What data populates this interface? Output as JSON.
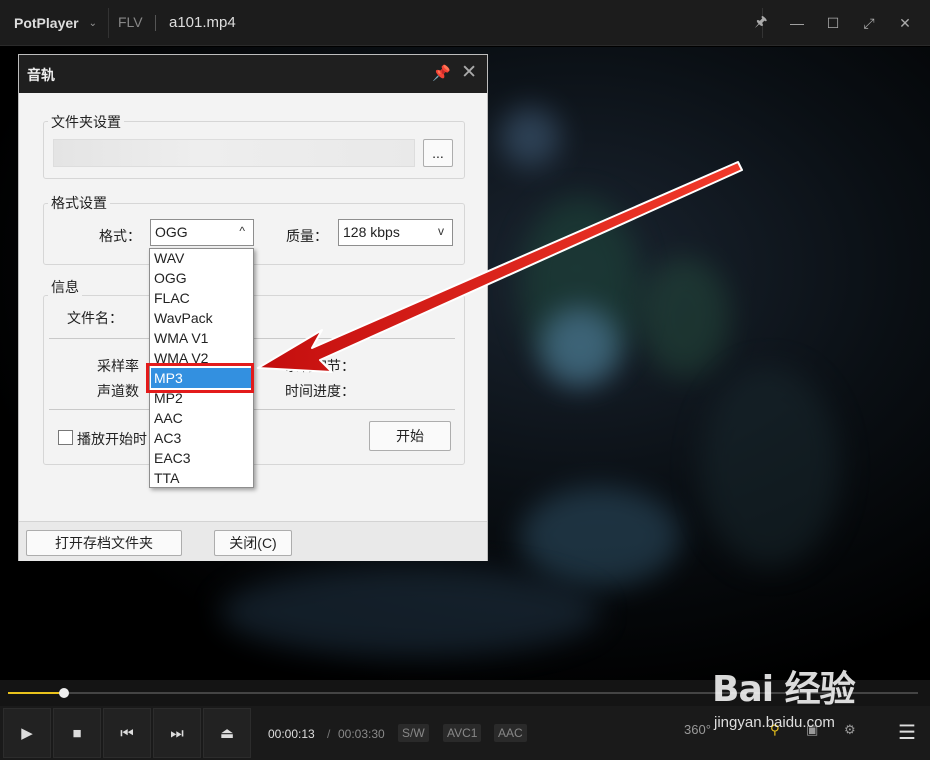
{
  "player": {
    "app_name": "PotPlayer",
    "format": "FLV",
    "file_name": "a101.mp4",
    "time_current": "00:00:13",
    "time_separator": "/",
    "time_total": "00:03:30",
    "tags": [
      "S/W",
      "AVC1",
      "AAC"
    ],
    "progress_fraction": 0.062,
    "right_icons": [
      "360°"
    ]
  },
  "dialog": {
    "title": "音轨",
    "folder_group": "文件夹设置",
    "browse_label": "...",
    "format_group": "格式设置",
    "format_label": "格式：",
    "format_value": "OGG",
    "format_arrow": "^",
    "quality_label": "质量：",
    "quality_value": "128 kbps",
    "quality_arrow": "v",
    "info_group": "信息",
    "filename_label": "文件名：",
    "samplerate_label": "采样率",
    "bytes_label": "录制字节：",
    "channels_label": "声道数",
    "progress_label": "时间进度：",
    "autostart_label": "播放开始时",
    "start_button": "开始",
    "open_folder_button": "打开存档文件夹",
    "close_button": "关闭(C)"
  },
  "dropdown": {
    "options": [
      "WAV",
      "OGG",
      "FLAC",
      "WavPack",
      "WMA V1",
      "WMA V2",
      "MP3",
      "MP2",
      "AAC",
      "AC3",
      "EAC3",
      "TTA"
    ],
    "selected": "MP3"
  },
  "watermark": {
    "logo": "Bai 经验",
    "url": "jingyan.baidu.com"
  },
  "colors": {
    "accent_seek": "#e9c21c",
    "selection": "#3390e0",
    "annotation": "#e31b1b"
  }
}
